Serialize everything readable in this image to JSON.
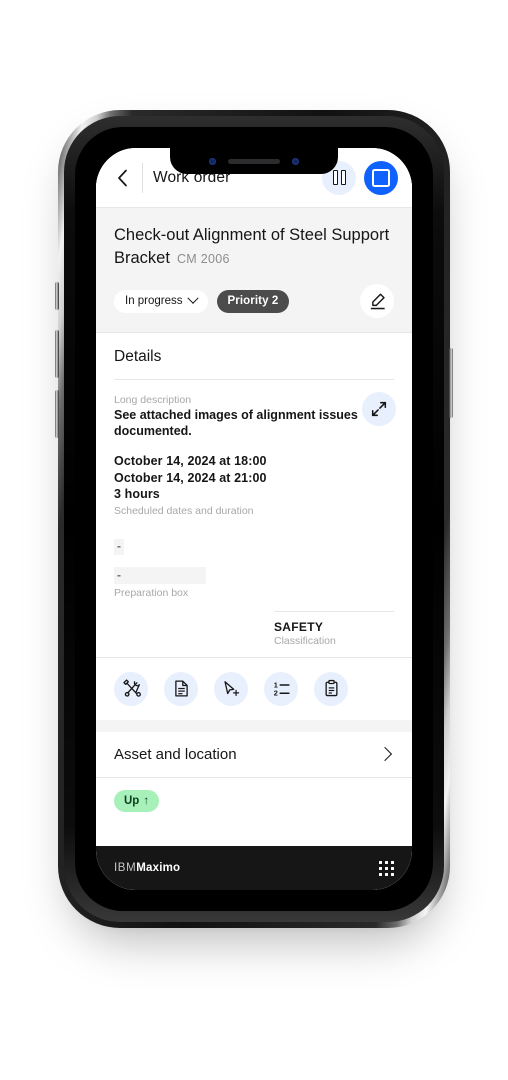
{
  "app": {
    "topbar": {
      "back_icon": "chevron-left-icon",
      "title": "Work order",
      "pause_icon": "pause-icon",
      "stop_icon": "stop-square-icon"
    },
    "title_block": {
      "work_order_title": "Check-out Alignment of Steel Support Bracket",
      "work_order_number": "CM 2006",
      "status_label": "In progress",
      "status_chevron_icon": "chevron-down-icon",
      "priority_label": "Priority 2",
      "edit_icon": "edit-pencil-icon"
    },
    "details": {
      "section_title": "Details",
      "long_description_label": "Long description",
      "long_description_value": "See attached images of alignment issues documented.",
      "expand_icon": "expand-arrows-icon",
      "schedule": {
        "start": "October 14, 2024  at  18:00",
        "end": "October 14, 2024  at  21:00",
        "duration": "3 hours",
        "caption": "Scheduled dates and duration"
      },
      "preparation": {
        "value_1": "-",
        "value_2": "-",
        "caption": "Preparation box"
      },
      "classification": {
        "value": "SAFETY",
        "caption": "Classification"
      }
    },
    "action_icons": [
      {
        "name": "tools-icon"
      },
      {
        "name": "document-icon"
      },
      {
        "name": "cursor-add-icon"
      },
      {
        "name": "numbered-list-icon"
      },
      {
        "name": "clipboard-icon"
      }
    ],
    "asset_section": {
      "label": "Asset and location",
      "chevron_icon": "chevron-right-icon"
    },
    "up_badge": {
      "label": "Up",
      "arrow": "↑"
    },
    "footer": {
      "brand_prefix": "IBM",
      "brand_name": "Maximo",
      "grid_icon": "app-grid-icon"
    }
  },
  "colors": {
    "accent_blue": "#0f62fe",
    "icon_bg": "#e8effd",
    "gray_bg": "#f4f4f4",
    "priority_pill": "#4c4c4c",
    "up_pill": "#a7f0ba",
    "footer_bg": "#161616"
  }
}
